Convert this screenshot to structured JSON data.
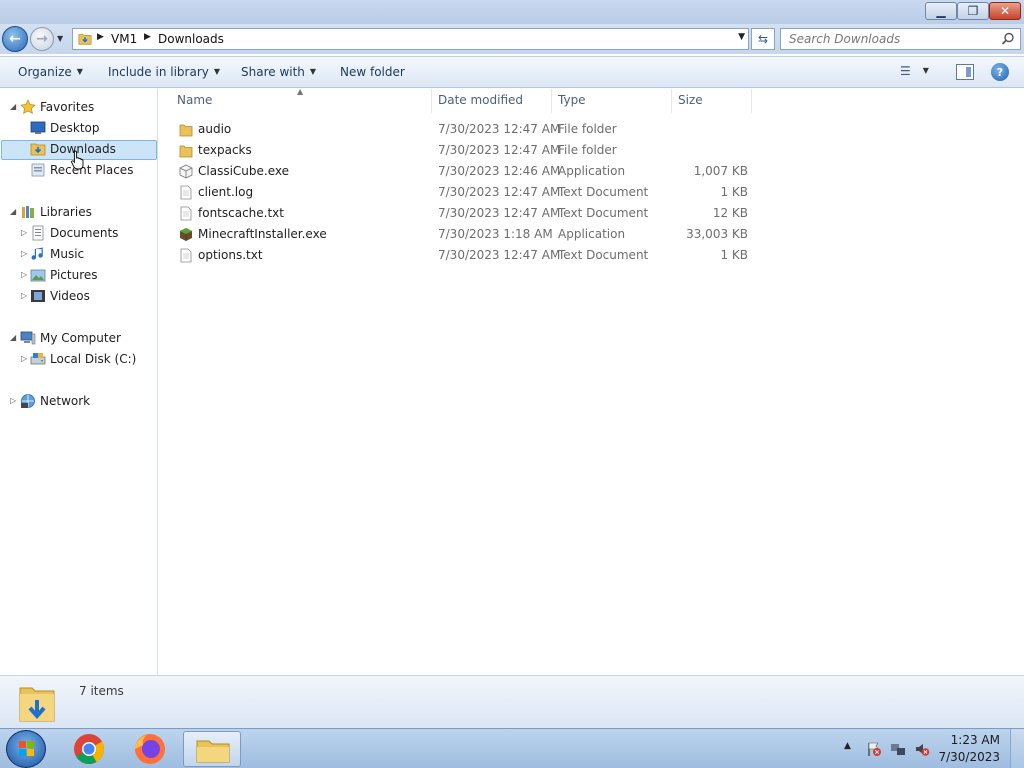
{
  "window": {
    "buttons": {
      "minimize": "▁",
      "maximize": "❐",
      "close": "✕"
    }
  },
  "address_bar": {
    "breadcrumbs": [
      "VM1",
      "Downloads"
    ],
    "search_placeholder": "Search Downloads"
  },
  "toolbar": {
    "organize": "Organize",
    "include_in_library": "Include in library",
    "share_with": "Share with",
    "new_folder": "New folder"
  },
  "nav_pane": {
    "favorites": {
      "label": "Favorites",
      "items": [
        {
          "label": "Desktop",
          "icon": "desktop-icon"
        },
        {
          "label": "Downloads",
          "icon": "downloads-folder-icon",
          "selected": true
        },
        {
          "label": "Recent Places",
          "icon": "recent-places-icon"
        }
      ]
    },
    "libraries": {
      "label": "Libraries",
      "items": [
        {
          "label": "Documents",
          "icon": "documents-icon"
        },
        {
          "label": "Music",
          "icon": "music-icon"
        },
        {
          "label": "Pictures",
          "icon": "pictures-icon"
        },
        {
          "label": "Videos",
          "icon": "videos-icon"
        }
      ]
    },
    "computer": {
      "label": "My Computer",
      "items": [
        {
          "label": "Local Disk (C:)",
          "icon": "hard-disk-icon"
        }
      ]
    },
    "network": {
      "label": "Network"
    }
  },
  "file_list": {
    "columns": [
      "Name",
      "Date modified",
      "Type",
      "Size"
    ],
    "rows": [
      {
        "name": "audio",
        "date": "7/30/2023 12:47 AM",
        "type": "File folder",
        "size": "",
        "icon": "folder-icon"
      },
      {
        "name": "texpacks",
        "date": "7/30/2023 12:47 AM",
        "type": "File folder",
        "size": "",
        "icon": "folder-icon"
      },
      {
        "name": "ClassiCube.exe",
        "date": "7/30/2023 12:46 AM",
        "type": "Application",
        "size": "1,007 KB",
        "icon": "cube-app-icon"
      },
      {
        "name": "client.log",
        "date": "7/30/2023 12:47 AM",
        "type": "Text Document",
        "size": "1 KB",
        "icon": "text-file-icon"
      },
      {
        "name": "fontscache.txt",
        "date": "7/30/2023 12:47 AM",
        "type": "Text Document",
        "size": "12 KB",
        "icon": "text-file-icon"
      },
      {
        "name": "MinecraftInstaller.exe",
        "date": "7/30/2023 1:18 AM",
        "type": "Application",
        "size": "33,003 KB",
        "icon": "minecraft-block-icon"
      },
      {
        "name": "options.txt",
        "date": "7/30/2023 12:47 AM",
        "type": "Text Document",
        "size": "1 KB",
        "icon": "text-file-icon"
      }
    ]
  },
  "details_pane": {
    "item_count": "7 items"
  },
  "taskbar": {
    "apps": [
      "chrome-icon",
      "firefox-icon",
      "explorer-icon"
    ],
    "clock": {
      "time": "1:23 AM",
      "date": "7/30/2023"
    }
  },
  "colors": {
    "selection": "#cce4f7",
    "selection_border": "#7eb4ea",
    "link_text": "#1e395b"
  }
}
